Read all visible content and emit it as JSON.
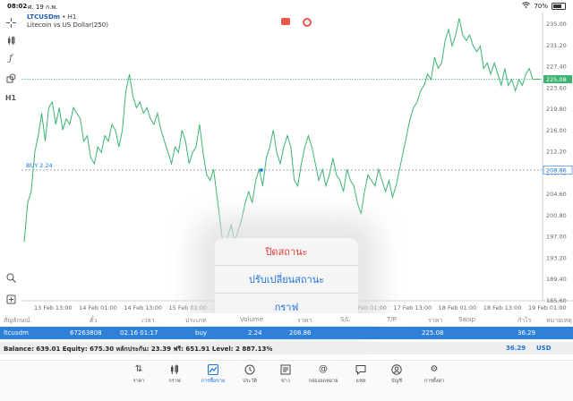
{
  "status_bar": {
    "time": "08:02",
    "date": "ศ. 19 ก.พ.",
    "battery": "70%"
  },
  "symbol": {
    "name": "LTCUSDm",
    "timeframe": "H1",
    "description": "Litecoin vs US Dollar(250)"
  },
  "tools": {
    "timeframe": "H1"
  },
  "chart_data": {
    "type": "line",
    "symbol": "LTCUSDm",
    "timeframe": "H1",
    "ylim": [
      185.5,
      237
    ],
    "y_ticks": [
      "235.00",
      "231.20",
      "227.40",
      "223.60",
      "219.80",
      "216.00",
      "212.20",
      "208.40",
      "204.60",
      "200.80",
      "197.00",
      "193.20",
      "189.40",
      "185.60"
    ],
    "x_ticks": [
      "13 Feb 13:00",
      "14 Feb 01:00",
      "14 Feb 13:00",
      "15 Feb 01:00",
      "15 Feb 13:00",
      "16 Feb 01:00",
      "16 Feb 13:00",
      "17 Feb 01:00",
      "17 Feb 13:00",
      "18 Feb 01:00",
      "18 Feb 13:00",
      "19 Feb 01:00"
    ],
    "current_price": 225.08,
    "current_price_label": "225.08",
    "buy_line": {
      "label": "BUY 2.24",
      "price": 208.86,
      "price_label": "208.86"
    },
    "values": [
      196.0,
      203.0,
      205.0,
      212.0,
      215.0,
      219.0,
      214.0,
      220.0,
      221.0,
      217.0,
      220.0,
      216.0,
      218.0,
      217.0,
      220.0,
      219.0,
      218.0,
      214.0,
      215.0,
      211.0,
      210.0,
      213.0,
      212.0,
      215.0,
      214.0,
      217.0,
      216.0,
      213.0,
      216.0,
      223.0,
      226.0,
      222.0,
      220.0,
      221.0,
      219.0,
      220.0,
      218.0,
      217.0,
      219.0,
      216.0,
      214.0,
      212.0,
      210.0,
      213.0,
      212.0,
      216.0,
      214.0,
      210.0,
      212.0,
      213.0,
      217.0,
      212.0,
      208.0,
      207.0,
      209.0,
      204.0,
      199.0,
      194.0,
      197.0,
      199.0,
      196.0,
      198.0,
      200.0,
      203.0,
      205.0,
      203.0,
      207.0,
      209.0,
      206.0,
      211.0,
      213.0,
      216.0,
      212.0,
      210.0,
      213.0,
      215.0,
      213.0,
      207.0,
      206.0,
      210.0,
      213.0,
      215.0,
      213.0,
      210.0,
      207.0,
      209.0,
      206.0,
      208.0,
      211.0,
      208.0,
      207.0,
      205.0,
      209.0,
      207.0,
      206.0,
      203.0,
      201.0,
      205.0,
      208.0,
      207.0,
      206.0,
      209.0,
      207.0,
      205.0,
      207.0,
      204.0,
      206.0,
      209.0,
      212.0,
      215.0,
      218.0,
      220.0,
      221.0,
      223.0,
      224.0,
      226.0,
      225.0,
      229.0,
      227.0,
      228.0,
      232.0,
      234.0,
      231.0,
      233.0,
      236.0,
      233.0,
      232.0,
      233.0,
      231.0,
      230.0,
      231.0,
      227.0,
      228.0,
      226.0,
      228.0,
      226.0,
      224.0,
      227.0,
      224.0,
      225.0,
      223.0,
      225.0,
      224.0,
      226.0,
      227.0,
      225.0,
      225.1,
      225.08
    ]
  },
  "trade_menu": {
    "close": "ปิดสถานะ",
    "modify": "ปรับเปลี่ยนสถานะ",
    "chart": "กราฟ"
  },
  "table": {
    "headers": [
      "สัญลักษณ์",
      "ตั๋ว",
      "เวลา",
      "ประเภท",
      "Volume",
      "ราคา",
      "S/L",
      "T/P",
      "ราคา",
      "Swap",
      "กำไร",
      "หมายเหตุ"
    ],
    "row": {
      "symbol": "ltcusdm",
      "ticket": "67263808",
      "time": "02.16 01:17",
      "type": "buy",
      "volume": "2.24",
      "open_price": "208.86",
      "current_price": "225.08",
      "profit": "36.29"
    }
  },
  "balance": {
    "text": "Balance: 639.01 Equity: 675.30 หลักประกัน: 23.39 ฟรี: 651.91 Level: 2 887.13%",
    "profit": "36.29",
    "currency": "USD"
  },
  "tabbar": [
    {
      "label": "ราคา",
      "icon": "arrows-icon"
    },
    {
      "label": "กราฟ",
      "icon": "candles-icon"
    },
    {
      "label": "การซื้อขาย",
      "icon": "trade-icon"
    },
    {
      "label": "ประวัติ",
      "icon": "history-icon"
    },
    {
      "label": "ข่าว",
      "icon": "news-icon"
    },
    {
      "label": "กล่องจดหมาย",
      "icon": "mail-icon"
    },
    {
      "label": "แชท",
      "icon": "chat-icon"
    },
    {
      "label": "บัญชี",
      "icon": "account-icon"
    },
    {
      "label": "การตั้งค่า",
      "icon": "settings-icon"
    }
  ],
  "colors": {
    "line": "#3cb371",
    "accent": "#1a73d9",
    "danger": "#e53935",
    "selected_row": "#2f80d8"
  }
}
